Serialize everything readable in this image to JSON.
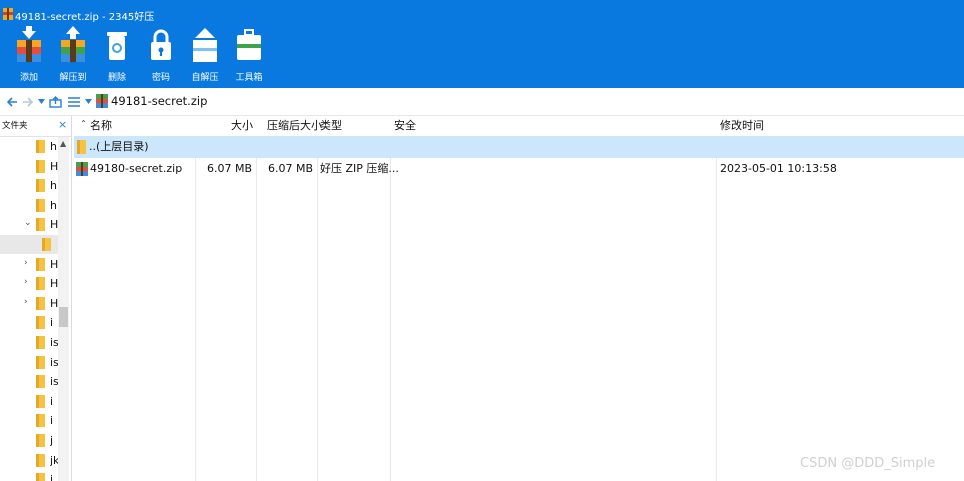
{
  "window": {
    "title": "49181-secret.zip - 2345好压"
  },
  "toolbar": {
    "buttons": [
      {
        "label": "添加",
        "icon": "add-archive-icon"
      },
      {
        "label": "解压到",
        "icon": "extract-to-icon"
      },
      {
        "label": "删除",
        "icon": "delete-recycle-icon"
      },
      {
        "label": "密码",
        "icon": "lock-icon"
      },
      {
        "label": "自解压",
        "icon": "self-extract-icon"
      },
      {
        "label": "工具箱",
        "icon": "toolbox-icon"
      }
    ]
  },
  "navbar": {
    "icons": [
      "back-arrow-icon",
      "forward-arrow-icon",
      "dropdown-icon",
      "up-folder-icon",
      "view-list-icon",
      "dropdown-icon"
    ],
    "path": "49181-secret.zip"
  },
  "tree": {
    "title": "文件夹",
    "close": "×",
    "rows": [
      {
        "label": "h",
        "arrow": "^"
      },
      {
        "label": "H",
        "arrow": ""
      },
      {
        "label": "h",
        "arrow": ""
      },
      {
        "label": "h",
        "arrow": ""
      },
      {
        "label": "H",
        "arrow": "v"
      },
      {
        "label": "",
        "arrow": ""
      },
      {
        "label": "H",
        "arrow": ">"
      },
      {
        "label": "H",
        "arrow": ">"
      },
      {
        "label": "H",
        "arrow": ">"
      },
      {
        "label": "i",
        "arrow": ""
      },
      {
        "label": "is",
        "arrow": ""
      },
      {
        "label": "is",
        "arrow": ""
      },
      {
        "label": "is",
        "arrow": ""
      },
      {
        "label": "i",
        "arrow": ""
      },
      {
        "label": "i",
        "arrow": ""
      },
      {
        "label": "j",
        "arrow": ""
      },
      {
        "label": "jk",
        "arrow": ""
      },
      {
        "label": "i",
        "arrow": ""
      }
    ]
  },
  "list": {
    "sort_indicator": "ˆ",
    "columns": [
      "名称",
      "大小",
      "压缩后大小",
      "类型",
      "安全",
      "修改时间"
    ],
    "rows": [
      {
        "name": "..(上层目录)",
        "size": "",
        "packed": "",
        "type": "",
        "security": "",
        "modified": ""
      },
      {
        "name": "49180-secret.zip",
        "size": "6.07 MB",
        "packed": "6.07 MB",
        "type": "好压 ZIP 压缩...",
        "security": "",
        "modified": "2023-05-01 10:13:58"
      }
    ]
  },
  "watermark": "CSDN @DDD_Simple",
  "colors": {
    "titlebar": "#0a79df",
    "selection": "#cce6fb",
    "folder": "#f5c242",
    "link": "#2a7fd4"
  }
}
